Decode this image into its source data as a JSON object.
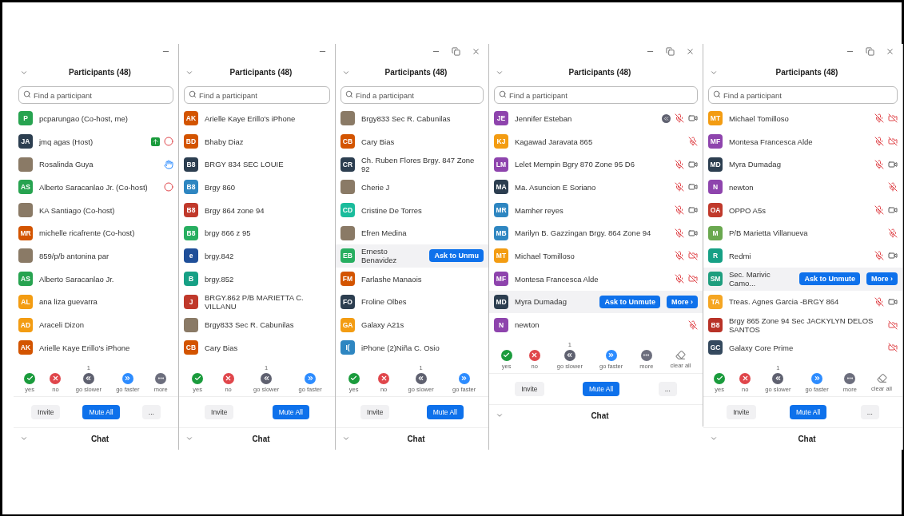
{
  "panels": [
    {
      "window_controls": [
        {
          "kind": "minimize"
        }
      ],
      "title": "Participants (48)",
      "search": {
        "placeholder": "Find a participant"
      },
      "participants": [
        {
          "name": "pcparungao (Co-host, me)",
          "avatar": {
            "kind": "initials",
            "initials": "P",
            "color": "#27a350"
          },
          "hovered": false
        },
        {
          "name": "jmq agas (Host)",
          "avatar": {
            "kind": "initials",
            "initials": "JA",
            "color": "#2c3e50"
          },
          "hovered": false,
          "indicators": [
            {
              "kind": "share"
            },
            {
              "kind": "record"
            }
          ]
        },
        {
          "name": "Rosalinda Guya",
          "avatar": {
            "kind": "photo"
          },
          "hovered": false,
          "indicators": [
            {
              "kind": "hand"
            }
          ]
        },
        {
          "name": "Alberto Saracanlao Jr. (Co-host)",
          "avatar": {
            "kind": "initials",
            "initials": "AS",
            "color": "#27a350"
          },
          "hovered": false,
          "indicators": [
            {
              "kind": "record"
            }
          ]
        },
        {
          "name": "KA Santiago (Co-host)",
          "avatar": {
            "kind": "photo"
          },
          "hovered": false
        },
        {
          "name": "michelle ricafrente (Co-host)",
          "avatar": {
            "kind": "initials",
            "initials": "MR",
            "color": "#d35400"
          },
          "hovered": false
        },
        {
          "name": "859/p/b antonina par",
          "avatar": {
            "kind": "photo"
          },
          "hovered": false
        },
        {
          "name": "Alberto Saracanlao Jr.",
          "avatar": {
            "kind": "initials",
            "initials": "AS",
            "color": "#27a350"
          },
          "hovered": false
        },
        {
          "name": "ana liza guevarra",
          "avatar": {
            "kind": "initials",
            "initials": "AL",
            "color": "#f39c12"
          },
          "hovered": false
        },
        {
          "name": "Araceli Dizon",
          "avatar": {
            "kind": "initials",
            "initials": "AD",
            "color": "#f39c12"
          },
          "hovered": false
        },
        {
          "name": "Arielle Kaye Erillo's iPhone",
          "avatar": {
            "kind": "initials",
            "initials": "AK",
            "color": "#d35400"
          },
          "hovered": false
        }
      ],
      "reactions": [
        {
          "kind": "yes",
          "label": "yes"
        },
        {
          "kind": "no",
          "label": "no"
        },
        {
          "kind": "slower",
          "label": "go slower",
          "count": "1"
        },
        {
          "kind": "faster",
          "label": "go faster"
        },
        {
          "kind": "more",
          "label": "more"
        }
      ],
      "buttons": [
        {
          "kind": "secondary",
          "label": "Invite"
        },
        {
          "kind": "primary",
          "label": "Mute All"
        },
        {
          "kind": "secondary",
          "label": "..."
        }
      ],
      "chat_title": "Chat"
    },
    {
      "window_controls": [
        {
          "kind": "minimize"
        }
      ],
      "title": "Participants (48)",
      "search": {
        "placeholder": "Find a participant"
      },
      "participants": [
        {
          "name": "Arielle Kaye Erillo's iPhone",
          "avatar": {
            "kind": "initials",
            "initials": "AK",
            "color": "#d35400"
          },
          "hovered": false
        },
        {
          "name": "Bhaby Diaz",
          "avatar": {
            "kind": "initials",
            "initials": "BD",
            "color": "#d35400"
          },
          "hovered": false
        },
        {
          "name": "BRGY 834 SEC LOUIE",
          "avatar": {
            "kind": "initials",
            "initials": "B8",
            "color": "#2c3e50"
          },
          "hovered": false
        },
        {
          "name": "Brgy 860",
          "avatar": {
            "kind": "initials",
            "initials": "B8",
            "color": "#2e86c1"
          },
          "hovered": false
        },
        {
          "name": "Brgy 864 zone 94",
          "avatar": {
            "kind": "initials",
            "initials": "B8",
            "color": "#c0392b"
          },
          "hovered": false
        },
        {
          "name": "brgy 866 z 95",
          "avatar": {
            "kind": "initials",
            "initials": "B8",
            "color": "#27ae60"
          },
          "hovered": false
        },
        {
          "name": "brgy.842",
          "avatar": {
            "kind": "initials",
            "initials": "e",
            "color": "#1f4f99"
          },
          "hovered": false
        },
        {
          "name": "brgy.852",
          "avatar": {
            "kind": "initials",
            "initials": "B",
            "color": "#16a085"
          },
          "hovered": false
        },
        {
          "name": "BRGY.862 P/B MARIETTA C. VILLANU",
          "avatar": {
            "kind": "initials",
            "initials": "J",
            "color": "#c0392b"
          },
          "hovered": false
        },
        {
          "name": "Brgy833 Sec R. Cabunilas",
          "avatar": {
            "kind": "photo"
          },
          "hovered": false
        },
        {
          "name": "Cary Bias",
          "avatar": {
            "kind": "initials",
            "initials": "CB",
            "color": "#d35400"
          },
          "hovered": false
        }
      ],
      "reactions": [
        {
          "kind": "yes",
          "label": "yes"
        },
        {
          "kind": "no",
          "label": "no"
        },
        {
          "kind": "slower",
          "label": "go slower",
          "count": "1"
        },
        {
          "kind": "faster",
          "label": "go faster"
        }
      ],
      "buttons": [
        {
          "kind": "secondary",
          "label": "Invite"
        },
        {
          "kind": "primary",
          "label": "Mute All"
        }
      ],
      "chat_title": "Chat"
    },
    {
      "window_controls": [
        {
          "kind": "minimize"
        },
        {
          "kind": "restore"
        },
        {
          "kind": "close"
        }
      ],
      "title": "Participants (48)",
      "search": {
        "placeholder": "Find a participant"
      },
      "participants": [
        {
          "name": "Brgy833 Sec R. Cabunilas",
          "avatar": {
            "kind": "photo"
          },
          "hovered": false
        },
        {
          "name": "Cary Bias",
          "avatar": {
            "kind": "initials",
            "initials": "CB",
            "color": "#d35400"
          },
          "hovered": false
        },
        {
          "name": "Ch. Ruben Flores Brgy. 847 Zone 92",
          "avatar": {
            "kind": "initials",
            "initials": "CR",
            "color": "#2c3e50"
          },
          "hovered": false
        },
        {
          "name": "Cherie J",
          "avatar": {
            "kind": "photo"
          },
          "hovered": false
        },
        {
          "name": "Cristine De Torres",
          "avatar": {
            "kind": "initials",
            "initials": "CD",
            "color": "#1abc9c"
          },
          "hovered": false
        },
        {
          "name": "Efren Medina",
          "avatar": {
            "kind": "photo"
          },
          "hovered": false
        },
        {
          "name": "Ernesto Benavidez",
          "avatar": {
            "kind": "initials",
            "initials": "EB",
            "color": "#27ae60"
          },
          "hovered": true,
          "actions": [
            "Ask to Unmu"
          ]
        },
        {
          "name": "Farlashe Manaois",
          "avatar": {
            "kind": "initials",
            "initials": "FM",
            "color": "#d35400"
          },
          "hovered": false
        },
        {
          "name": "Froline Olbes",
          "avatar": {
            "kind": "initials",
            "initials": "FO",
            "color": "#2c3e50"
          },
          "hovered": false
        },
        {
          "name": "Galaxy A21s",
          "avatar": {
            "kind": "initials",
            "initials": "GA",
            "color": "#f39c12"
          },
          "hovered": false
        },
        {
          "name": "iPhone (2)Niña C. Osio",
          "avatar": {
            "kind": "initials",
            "initials": "I(",
            "color": "#2e86c1"
          },
          "hovered": false
        }
      ],
      "reactions": [
        {
          "kind": "yes",
          "label": "yes"
        },
        {
          "kind": "no",
          "label": "no"
        },
        {
          "kind": "slower",
          "label": "go slower",
          "count": "1"
        },
        {
          "kind": "faster",
          "label": "go faster"
        }
      ],
      "buttons": [
        {
          "kind": "secondary",
          "label": "Invite"
        },
        {
          "kind": "primary",
          "label": "Mute All"
        }
      ],
      "chat_title": "Chat"
    },
    {
      "window_controls": [
        {
          "kind": "minimize"
        },
        {
          "kind": "restore"
        },
        {
          "kind": "close"
        }
      ],
      "title": "Participants (48)",
      "search": {
        "placeholder": "Find a participant"
      },
      "participants": [
        {
          "name": "Jennifer Esteban",
          "avatar": {
            "kind": "initials",
            "initials": "JE",
            "color": "#8e44ad"
          },
          "hovered": false,
          "indicators": [
            {
              "kind": "slower"
            },
            {
              "kind": "mic-muted"
            },
            {
              "kind": "video"
            }
          ]
        },
        {
          "name": "Kagawad Jaravata 865",
          "avatar": {
            "kind": "initials",
            "initials": "KJ",
            "color": "#f39c12"
          },
          "hovered": false,
          "indicators": [
            {
              "kind": "mic-muted"
            }
          ]
        },
        {
          "name": "Lelet Mempin Bgry 870 Zone 95 D6",
          "avatar": {
            "kind": "initials",
            "initials": "LM",
            "color": "#8e44ad"
          },
          "hovered": false,
          "indicators": [
            {
              "kind": "mic-muted"
            },
            {
              "kind": "video"
            }
          ]
        },
        {
          "name": "Ma. Asuncion E Soriano",
          "avatar": {
            "kind": "initials",
            "initials": "MA",
            "color": "#2c3e50"
          },
          "hovered": false,
          "indicators": [
            {
              "kind": "mic-muted"
            },
            {
              "kind": "video"
            }
          ]
        },
        {
          "name": "Mamher reyes",
          "avatar": {
            "kind": "initials",
            "initials": "MR",
            "color": "#2e86c1"
          },
          "hovered": false,
          "indicators": [
            {
              "kind": "mic-muted"
            },
            {
              "kind": "video"
            }
          ]
        },
        {
          "name": "Marilyn B. Gazzingan Brgy. 864 Zone 94",
          "avatar": {
            "kind": "initials",
            "initials": "MB",
            "color": "#2e86c1"
          },
          "hovered": false,
          "indicators": [
            {
              "kind": "mic-muted"
            },
            {
              "kind": "video"
            }
          ]
        },
        {
          "name": "Michael Tomilloso",
          "avatar": {
            "kind": "initials",
            "initials": "MT",
            "color": "#f39c12"
          },
          "hovered": false,
          "indicators": [
            {
              "kind": "mic-muted"
            },
            {
              "kind": "video-off"
            }
          ]
        },
        {
          "name": "Montesa Francesca Alde",
          "avatar": {
            "kind": "initials",
            "initials": "MF",
            "color": "#8e44ad"
          },
          "hovered": false,
          "indicators": [
            {
              "kind": "mic-muted"
            },
            {
              "kind": "video-off"
            }
          ]
        },
        {
          "name": "Myra Dumadag",
          "avatar": {
            "kind": "initials",
            "initials": "MD",
            "color": "#2c3e50"
          },
          "hovered": true,
          "actions": [
            "Ask to Unmute",
            "More ›"
          ]
        },
        {
          "name": "newton",
          "avatar": {
            "kind": "initials",
            "initials": "N",
            "color": "#8e44ad"
          },
          "hovered": false,
          "indicators": [
            {
              "kind": "mic-muted"
            }
          ]
        }
      ],
      "reactions": [
        {
          "kind": "yes",
          "label": "yes"
        },
        {
          "kind": "no",
          "label": "no"
        },
        {
          "kind": "slower",
          "label": "go slower",
          "count": "1"
        },
        {
          "kind": "faster",
          "label": "go faster"
        },
        {
          "kind": "more",
          "label": "more"
        },
        {
          "kind": "clear",
          "label": "clear all"
        }
      ],
      "buttons": [
        {
          "kind": "secondary",
          "label": "Invite"
        },
        {
          "kind": "primary",
          "label": "Mute All"
        },
        {
          "kind": "secondary",
          "label": "..."
        }
      ],
      "chat_title": "Chat"
    },
    {
      "window_controls": [
        {
          "kind": "minimize"
        },
        {
          "kind": "restore"
        },
        {
          "kind": "close"
        }
      ],
      "title": "Participants (48)",
      "search": {
        "placeholder": "Find a participant"
      },
      "participants": [
        {
          "name": "Michael Tomilloso",
          "avatar": {
            "kind": "initials",
            "initials": "MT",
            "color": "#f39c12"
          },
          "hovered": false,
          "indicators": [
            {
              "kind": "mic-muted"
            },
            {
              "kind": "video-off"
            }
          ]
        },
        {
          "name": "Montesa Francesca Alde",
          "avatar": {
            "kind": "initials",
            "initials": "MF",
            "color": "#8e44ad"
          },
          "hovered": false,
          "indicators": [
            {
              "kind": "mic-muted"
            },
            {
              "kind": "video-off"
            }
          ]
        },
        {
          "name": "Myra Dumadag",
          "avatar": {
            "kind": "initials",
            "initials": "MD",
            "color": "#2c3e50"
          },
          "hovered": false,
          "indicators": [
            {
              "kind": "mic-muted"
            },
            {
              "kind": "video"
            }
          ]
        },
        {
          "name": "newton",
          "avatar": {
            "kind": "initials",
            "initials": "N",
            "color": "#8e44ad"
          },
          "hovered": false,
          "indicators": [
            {
              "kind": "mic-muted"
            }
          ]
        },
        {
          "name": "OPPO A5s",
          "avatar": {
            "kind": "initials",
            "initials": "OA",
            "color": "#c0392b"
          },
          "hovered": false,
          "indicators": [
            {
              "kind": "mic-muted"
            },
            {
              "kind": "video"
            }
          ]
        },
        {
          "name": "P/B Marietta Villanueva",
          "avatar": {
            "kind": "initials",
            "initials": "M",
            "color": "#6aa84f"
          },
          "hovered": false,
          "indicators": [
            {
              "kind": "mic-muted"
            }
          ]
        },
        {
          "name": "Redmi",
          "avatar": {
            "kind": "initials",
            "initials": "R",
            "color": "#16a085"
          },
          "hovered": false,
          "indicators": [
            {
              "kind": "mic-muted"
            },
            {
              "kind": "video"
            }
          ]
        },
        {
          "name": "Sec. Marivic Camo...",
          "avatar": {
            "kind": "initials",
            "initials": "SM",
            "color": "#1e9e7e"
          },
          "hovered": true,
          "actions": [
            "Ask to Unmute",
            "More ›"
          ]
        },
        {
          "name": "Treas. Agnes Garcia -BRGY 864",
          "avatar": {
            "kind": "initials",
            "initials": "TA",
            "color": "#f5a623"
          },
          "hovered": false,
          "indicators": [
            {
              "kind": "mic-muted"
            },
            {
              "kind": "video"
            }
          ]
        },
        {
          "name": "Brgy 865 Zone 94 Sec JACKYLYN DELOS SANTOS",
          "avatar": {
            "kind": "initials",
            "initials": "B8",
            "color": "#b83227"
          },
          "hovered": false,
          "indicators": [
            {
              "kind": "video-off"
            }
          ]
        },
        {
          "name": "Galaxy Core Prime",
          "avatar": {
            "kind": "initials",
            "initials": "GC",
            "color": "#34495e"
          },
          "hovered": false,
          "indicators": [
            {
              "kind": "video-off"
            }
          ]
        }
      ],
      "reactions": [
        {
          "kind": "yes",
          "label": "yes"
        },
        {
          "kind": "no",
          "label": "no"
        },
        {
          "kind": "slower",
          "label": "go slower",
          "count": "1"
        },
        {
          "kind": "faster",
          "label": "go faster"
        },
        {
          "kind": "more",
          "label": "more"
        },
        {
          "kind": "clear",
          "label": "clear all"
        }
      ],
      "buttons": [
        {
          "kind": "secondary",
          "label": "Invite"
        },
        {
          "kind": "primary",
          "label": "Mute All"
        },
        {
          "kind": "secondary",
          "label": "..."
        }
      ],
      "chat_title": "Chat"
    }
  ]
}
